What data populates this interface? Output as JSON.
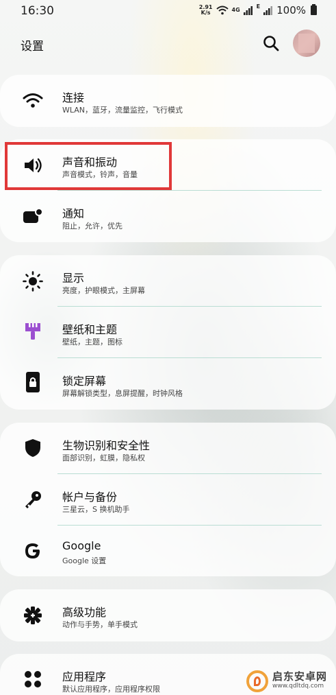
{
  "status_bar": {
    "time": "16:30",
    "speed_value": "2.91",
    "speed_unit": "K/s",
    "network": "4G",
    "network_e": "E",
    "battery": "100%"
  },
  "header": {
    "title": "设置"
  },
  "settings": {
    "connections": {
      "title": "连接",
      "subtitle": "WLAN，蓝牙，流量监控，飞行模式"
    },
    "sound": {
      "title": "声音和振动",
      "subtitle": "声音模式，铃声，音量"
    },
    "notifications": {
      "title": "通知",
      "subtitle": "阻止，允许，优先"
    },
    "display": {
      "title": "显示",
      "subtitle": "亮度，护眼模式，主屏幕"
    },
    "wallpaper": {
      "title": "壁纸和主题",
      "subtitle": "壁纸，主题，图标"
    },
    "lockscreen": {
      "title": "锁定屏幕",
      "subtitle": "屏幕解锁类型，息屏提醒，时钟风格"
    },
    "biometrics": {
      "title": "生物识别和安全性",
      "subtitle": "面部识别，虹膜，隐私权"
    },
    "accounts": {
      "title": "帐户与备份",
      "subtitle": "三星云，S 换机助手"
    },
    "google": {
      "title": "Google",
      "subtitle": "Google 设置"
    },
    "advanced": {
      "title": "高级功能",
      "subtitle": "动作与手势，单手模式"
    },
    "apps": {
      "title": "应用程序",
      "subtitle": "默认应用程序，应用程序权限"
    }
  },
  "watermark": {
    "title": "启东安卓网",
    "url": "www.qdltdq.com"
  },
  "colors": {
    "highlight": "#e03838",
    "wallpaper_icon": "#9b4fd0",
    "divider": "#b9ddd3"
  }
}
